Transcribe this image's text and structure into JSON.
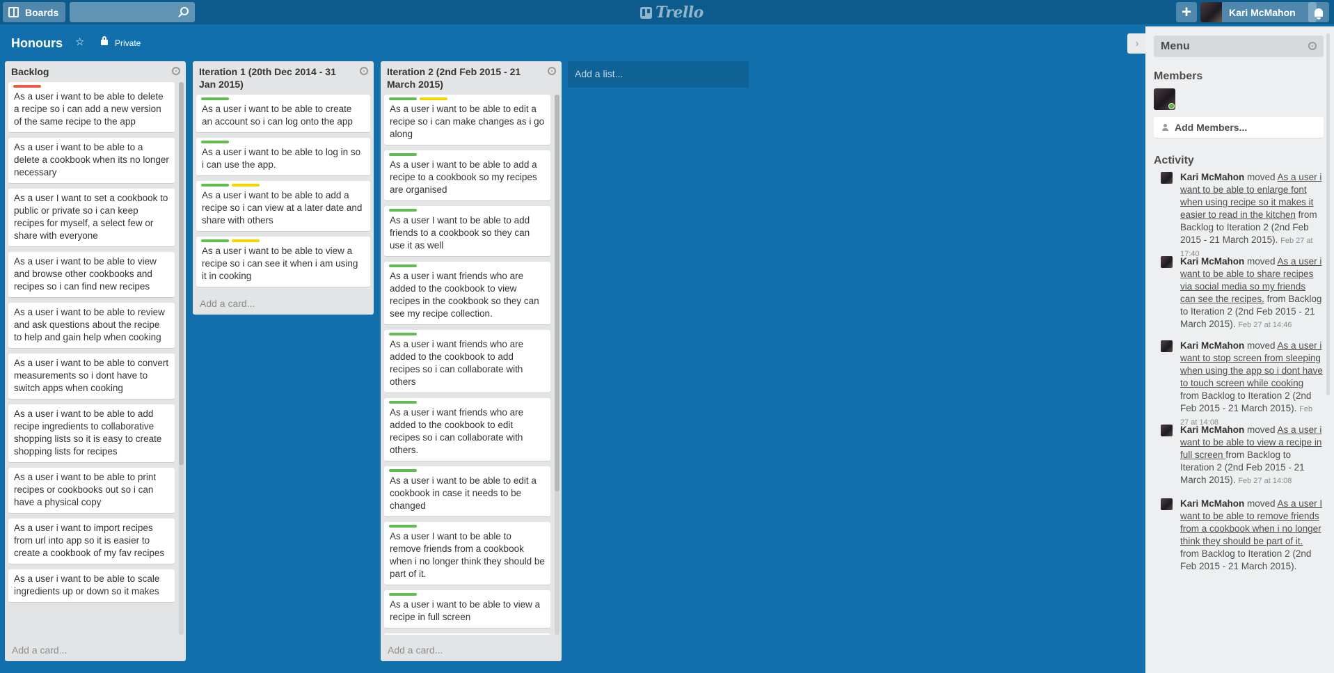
{
  "header": {
    "boards_label": "Boards",
    "search_value": "",
    "logo_text": "Trello",
    "user_name": "Kari McMahon"
  },
  "board": {
    "title": "Honours",
    "privacy": "Private"
  },
  "colors": {
    "background": "#1170ab",
    "header": "#0c5b8c",
    "green_label": "#61bd4f",
    "yellow_label": "#f2d600",
    "red_label": "#eb5a46"
  },
  "lists": [
    {
      "title": "Backlog",
      "add_card": "Add a card...",
      "cards": [
        {
          "text": "As a user i want to be able to delete a recipe so i can add a new version of the same recipe to the app",
          "labels": [
            "red"
          ]
        },
        {
          "text": "As a user i want to be able to a delete a cookbook when its no longer necessary",
          "labels": []
        },
        {
          "text": "As a user I want to set a cookbook to public or private so i can keep recipes for myself, a select few or share with everyone",
          "labels": []
        },
        {
          "text": "As a user i want to be able to view and browse other cookbooks and recipes so i can find new recipes",
          "labels": []
        },
        {
          "text": "As a user i want to be able to review and ask questions about the recipe to help and gain help when cooking",
          "labels": []
        },
        {
          "text": "As a user i want to be able to convert measurements so i dont have to switch apps when cooking",
          "labels": []
        },
        {
          "text": "As a user i want to be able to add recipe ingredients to collaborative shopping lists so it is easy to create shopping lists for recipes",
          "labels": []
        },
        {
          "text": "As a user i want to be able to print recipes or cookbooks out so i can have a physical copy",
          "labels": []
        },
        {
          "text": "As a user i want to import recipes from url into app so it is easier to create a cookbook of my fav recipes",
          "labels": []
        },
        {
          "text": "As a user i want to be able to scale ingredients up or down so it makes",
          "labels": []
        }
      ]
    },
    {
      "title": "Iteration 1 (20th Dec 2014 - 31 Jan 2015)",
      "add_card": "Add a card...",
      "cards": [
        {
          "text": "As a user i want to be able to create an account so i can log onto the app",
          "labels": [
            "green"
          ]
        },
        {
          "text": "As a user i want to be able to log in so i can use the app.",
          "labels": [
            "green"
          ]
        },
        {
          "text": "As a user i want to be able to add a recipe so i can view at a later date and share with others",
          "labels": [
            "green",
            "yellow"
          ]
        },
        {
          "text": "As a user i want to be able to view a recipe so i can see it when i am using it in cooking",
          "labels": [
            "green",
            "yellow"
          ]
        }
      ]
    },
    {
      "title": "Iteration 2 (2nd Feb 2015 - 21 March 2015)",
      "add_card": "Add a card...",
      "cards": [
        {
          "text": "As a user i want to be able to edit a recipe so i can make changes as i go along",
          "labels": [
            "green",
            "yellow"
          ]
        },
        {
          "text": "As a user i want to be able to add a recipe to a cookbook so my recipes are organised",
          "labels": [
            "green"
          ]
        },
        {
          "text": "As a user I want to be able to add friends to a cookbook so they can use it as well",
          "labels": [
            "green"
          ]
        },
        {
          "text": "As a user i want friends who are added to the cookbook to view recipes in the cookbook so they can see my recipe collection.",
          "labels": [
            "green"
          ]
        },
        {
          "text": "As a user i want friends who are added to the cookbook to add recipes so i can collaborate with others",
          "labels": [
            "green"
          ]
        },
        {
          "text": "As a user i want friends who are added to the cookbook to edit recipes so i can collaborate with others.",
          "labels": [
            "green"
          ]
        },
        {
          "text": "As a user i want to be able to edit a cookbook in case it needs to be changed",
          "labels": [
            "green"
          ]
        },
        {
          "text": "As a user I want to be able to remove friends from a cookbook when i no longer think they should be part of it.",
          "labels": [
            "green"
          ]
        },
        {
          "text": "As a user i want to be able to view a recipe in full screen",
          "labels": [
            "green"
          ]
        },
        {
          "text": "",
          "labels": [
            "green",
            "yellow"
          ]
        }
      ]
    }
  ],
  "add_list": "Add a list...",
  "sidebar": {
    "menu_title": "Menu",
    "members_heading": "Members",
    "add_members": "Add Members...",
    "activity_heading": "Activity",
    "activities": [
      {
        "user": "Kari McMahon",
        "verb": " moved ",
        "card": "As a user i want to be able to enlarge font when using recipe so it makes it easier to read in the kitchen",
        "rest": " from Backlog to Iteration 2 (2nd Feb 2015 - 21 March 2015).",
        "date": "Feb 27 at 17:40"
      },
      {
        "user": "Kari McMahon",
        "verb": " moved ",
        "card": "As a user i want to be able to share recipes via social media so my friends can see the recipes.",
        "rest": " from Backlog to Iteration 2 (2nd Feb 2015 - 21 March 2015).",
        "date": "Feb 27 at 14:46"
      },
      {
        "user": "Kari McMahon",
        "verb": " moved ",
        "card": "As a user i want to stop screen from sleeping when using the app so i dont have to touch screen while cooking",
        "rest": " from Backlog to Iteration 2 (2nd Feb 2015 - 21 March 2015).",
        "date": "Feb 27 at 14:08"
      },
      {
        "user": "Kari McMahon",
        "verb": " moved ",
        "card": "As a user i want to be able to view a recipe in full screen ",
        "rest": "from Backlog to Iteration 2 (2nd Feb 2015 - 21 March 2015).",
        "date": "Feb 27 at 14:08"
      },
      {
        "user": "Kari McMahon",
        "verb": " moved ",
        "card": "As a user I want to be able to remove friends from a cookbook when i no longer think they should be part of it.",
        "rest": " from Backlog to Iteration 2 (2nd Feb 2015 - 21 March 2015).",
        "date": ""
      }
    ]
  }
}
